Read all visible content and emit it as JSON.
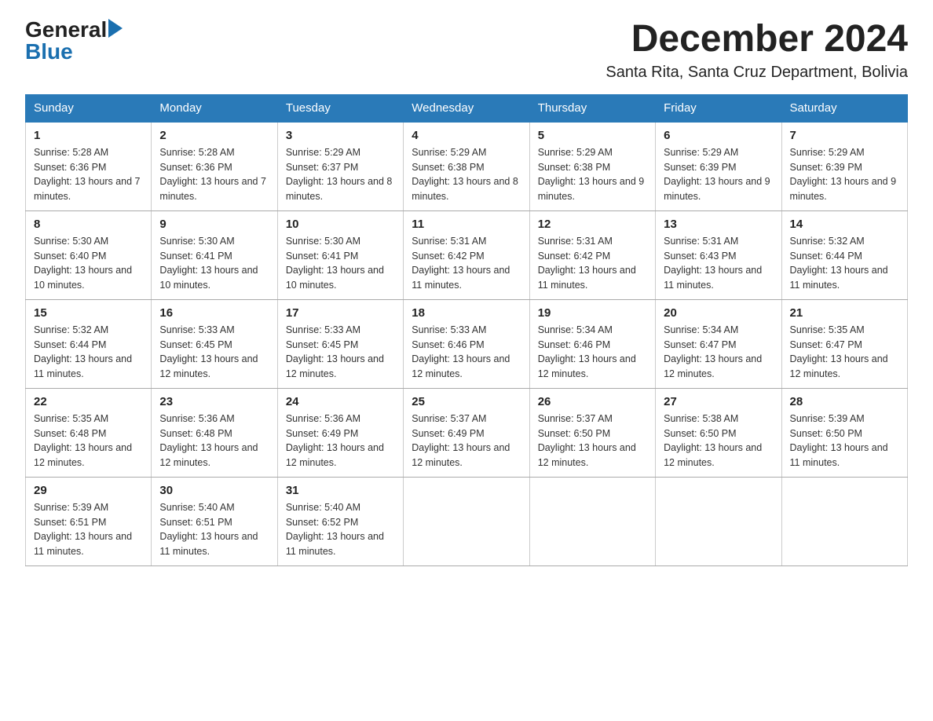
{
  "logo": {
    "general": "General",
    "blue": "Blue"
  },
  "header": {
    "month_title": "December 2024",
    "location": "Santa Rita, Santa Cruz Department, Bolivia"
  },
  "weekdays": [
    "Sunday",
    "Monday",
    "Tuesday",
    "Wednesday",
    "Thursday",
    "Friday",
    "Saturday"
  ],
  "weeks": [
    [
      {
        "day": "1",
        "sunrise": "5:28 AM",
        "sunset": "6:36 PM",
        "daylight": "13 hours and 7 minutes."
      },
      {
        "day": "2",
        "sunrise": "5:28 AM",
        "sunset": "6:36 PM",
        "daylight": "13 hours and 7 minutes."
      },
      {
        "day": "3",
        "sunrise": "5:29 AM",
        "sunset": "6:37 PM",
        "daylight": "13 hours and 8 minutes."
      },
      {
        "day": "4",
        "sunrise": "5:29 AM",
        "sunset": "6:38 PM",
        "daylight": "13 hours and 8 minutes."
      },
      {
        "day": "5",
        "sunrise": "5:29 AM",
        "sunset": "6:38 PM",
        "daylight": "13 hours and 9 minutes."
      },
      {
        "day": "6",
        "sunrise": "5:29 AM",
        "sunset": "6:39 PM",
        "daylight": "13 hours and 9 minutes."
      },
      {
        "day": "7",
        "sunrise": "5:29 AM",
        "sunset": "6:39 PM",
        "daylight": "13 hours and 9 minutes."
      }
    ],
    [
      {
        "day": "8",
        "sunrise": "5:30 AM",
        "sunset": "6:40 PM",
        "daylight": "13 hours and 10 minutes."
      },
      {
        "day": "9",
        "sunrise": "5:30 AM",
        "sunset": "6:41 PM",
        "daylight": "13 hours and 10 minutes."
      },
      {
        "day": "10",
        "sunrise": "5:30 AM",
        "sunset": "6:41 PM",
        "daylight": "13 hours and 10 minutes."
      },
      {
        "day": "11",
        "sunrise": "5:31 AM",
        "sunset": "6:42 PM",
        "daylight": "13 hours and 11 minutes."
      },
      {
        "day": "12",
        "sunrise": "5:31 AM",
        "sunset": "6:42 PM",
        "daylight": "13 hours and 11 minutes."
      },
      {
        "day": "13",
        "sunrise": "5:31 AM",
        "sunset": "6:43 PM",
        "daylight": "13 hours and 11 minutes."
      },
      {
        "day": "14",
        "sunrise": "5:32 AM",
        "sunset": "6:44 PM",
        "daylight": "13 hours and 11 minutes."
      }
    ],
    [
      {
        "day": "15",
        "sunrise": "5:32 AM",
        "sunset": "6:44 PM",
        "daylight": "13 hours and 11 minutes."
      },
      {
        "day": "16",
        "sunrise": "5:33 AM",
        "sunset": "6:45 PM",
        "daylight": "13 hours and 12 minutes."
      },
      {
        "day": "17",
        "sunrise": "5:33 AM",
        "sunset": "6:45 PM",
        "daylight": "13 hours and 12 minutes."
      },
      {
        "day": "18",
        "sunrise": "5:33 AM",
        "sunset": "6:46 PM",
        "daylight": "13 hours and 12 minutes."
      },
      {
        "day": "19",
        "sunrise": "5:34 AM",
        "sunset": "6:46 PM",
        "daylight": "13 hours and 12 minutes."
      },
      {
        "day": "20",
        "sunrise": "5:34 AM",
        "sunset": "6:47 PM",
        "daylight": "13 hours and 12 minutes."
      },
      {
        "day": "21",
        "sunrise": "5:35 AM",
        "sunset": "6:47 PM",
        "daylight": "13 hours and 12 minutes."
      }
    ],
    [
      {
        "day": "22",
        "sunrise": "5:35 AM",
        "sunset": "6:48 PM",
        "daylight": "13 hours and 12 minutes."
      },
      {
        "day": "23",
        "sunrise": "5:36 AM",
        "sunset": "6:48 PM",
        "daylight": "13 hours and 12 minutes."
      },
      {
        "day": "24",
        "sunrise": "5:36 AM",
        "sunset": "6:49 PM",
        "daylight": "13 hours and 12 minutes."
      },
      {
        "day": "25",
        "sunrise": "5:37 AM",
        "sunset": "6:49 PM",
        "daylight": "13 hours and 12 minutes."
      },
      {
        "day": "26",
        "sunrise": "5:37 AM",
        "sunset": "6:50 PM",
        "daylight": "13 hours and 12 minutes."
      },
      {
        "day": "27",
        "sunrise": "5:38 AM",
        "sunset": "6:50 PM",
        "daylight": "13 hours and 12 minutes."
      },
      {
        "day": "28",
        "sunrise": "5:39 AM",
        "sunset": "6:50 PM",
        "daylight": "13 hours and 11 minutes."
      }
    ],
    [
      {
        "day": "29",
        "sunrise": "5:39 AM",
        "sunset": "6:51 PM",
        "daylight": "13 hours and 11 minutes."
      },
      {
        "day": "30",
        "sunrise": "5:40 AM",
        "sunset": "6:51 PM",
        "daylight": "13 hours and 11 minutes."
      },
      {
        "day": "31",
        "sunrise": "5:40 AM",
        "sunset": "6:52 PM",
        "daylight": "13 hours and 11 minutes."
      },
      null,
      null,
      null,
      null
    ]
  ]
}
